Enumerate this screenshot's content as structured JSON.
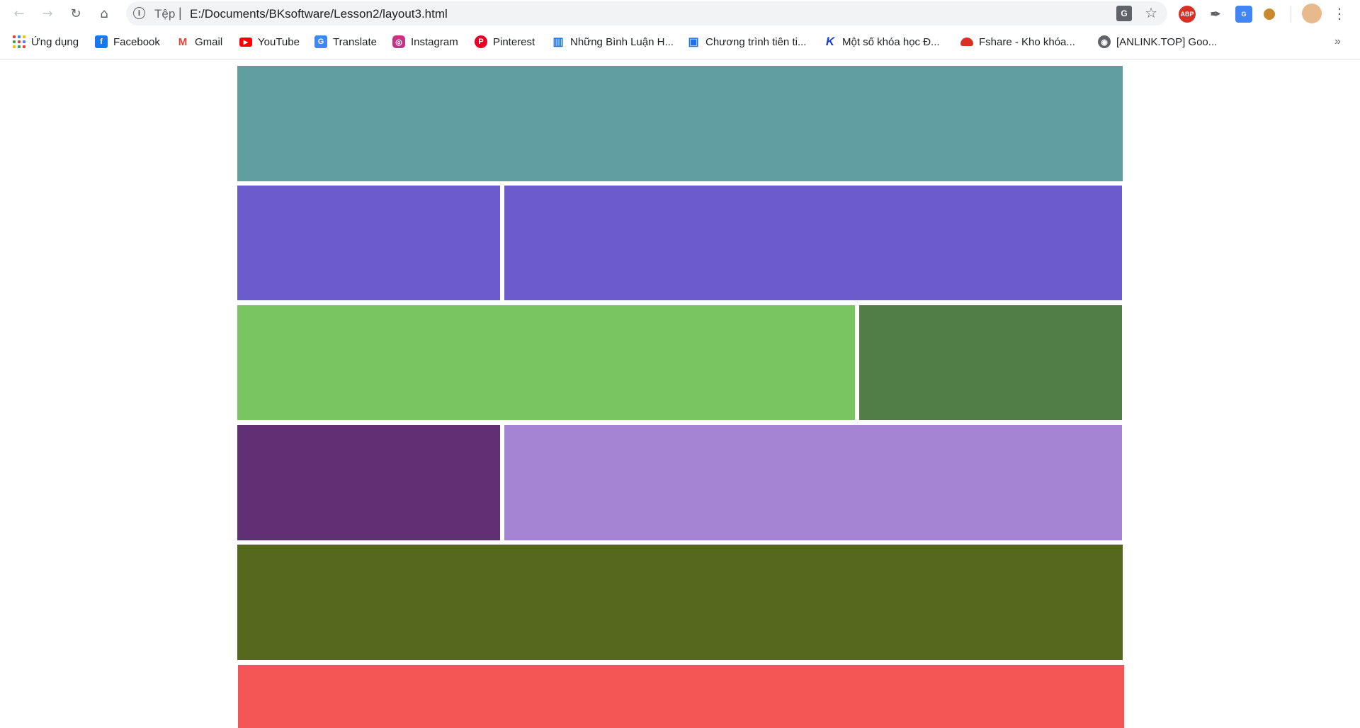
{
  "browser": {
    "address_scheme": "Tệp",
    "address_separator": "|",
    "url": "E:/Documents/BKsoftware/Lesson2/layout3.html",
    "ext_abp_label": "ABP",
    "bookmarks_overflow": "»",
    "bookmarks": [
      {
        "label": "Ứng dụng",
        "icon": "apps-grid-icon"
      },
      {
        "label": "Facebook",
        "icon": "facebook-icon"
      },
      {
        "label": "Gmail",
        "icon": "gmail-icon"
      },
      {
        "label": "YouTube",
        "icon": "youtube-icon"
      },
      {
        "label": "Translate",
        "icon": "translate-icon"
      },
      {
        "label": "Instagram",
        "icon": "instagram-icon"
      },
      {
        "label": "Pinterest",
        "icon": "pinterest-icon"
      },
      {
        "label": "Những Bình Luận H...",
        "icon": "book-icon"
      },
      {
        "label": "Chương trình tiên ti...",
        "icon": "layout-icon"
      },
      {
        "label": "Một số khóa học Đ...",
        "icon": "k-logo-icon"
      },
      {
        "label": "Fshare - Kho khóa...",
        "icon": "cloud-icon"
      },
      {
        "label": "[ANLINK.TOP] Goo...",
        "icon": "globe-icon"
      }
    ]
  },
  "layout_colors": {
    "header": "#619ea1",
    "row2_left": "#6b5bcd",
    "row2_right": "#6b5bcd",
    "row3_left": "#78c562",
    "row3_right": "#507d45",
    "row4_left": "#612d73",
    "row4_right": "#a483d3",
    "row5": "#56681d",
    "row6": "#f25553"
  }
}
